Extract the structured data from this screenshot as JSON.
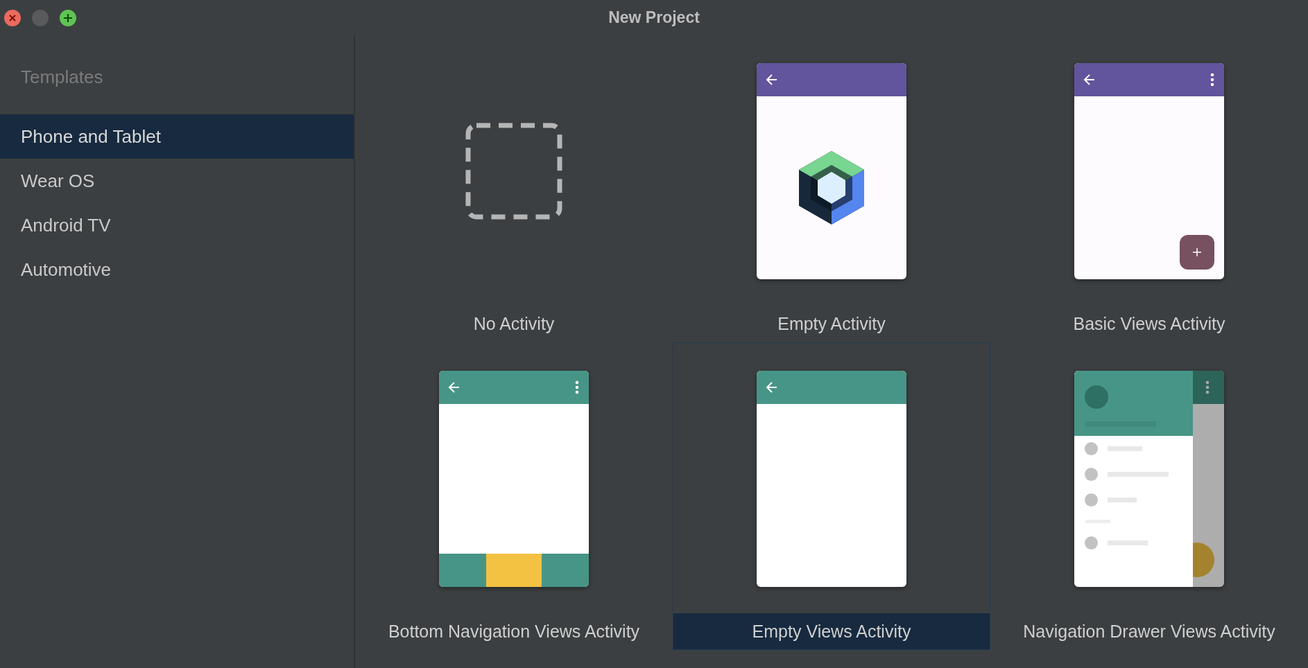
{
  "window": {
    "title": "New Project"
  },
  "sidebar": {
    "heading": "Templates",
    "items": [
      {
        "label": "Phone and Tablet",
        "selected": true
      },
      {
        "label": "Wear OS",
        "selected": false
      },
      {
        "label": "Android TV",
        "selected": false
      },
      {
        "label": "Automotive",
        "selected": false
      }
    ]
  },
  "templates": [
    {
      "label": "No Activity",
      "kind": "none",
      "selected": false
    },
    {
      "label": "Empty Activity",
      "kind": "compose",
      "selected": false
    },
    {
      "label": "Basic Views Activity",
      "kind": "basic",
      "selected": false
    },
    {
      "label": "Bottom Navigation Views Activity",
      "kind": "bottomnav",
      "selected": false
    },
    {
      "label": "Empty Views Activity",
      "kind": "empty",
      "selected": true
    },
    {
      "label": "Navigation Drawer Views Activity",
      "kind": "drawer",
      "selected": false
    }
  ]
}
